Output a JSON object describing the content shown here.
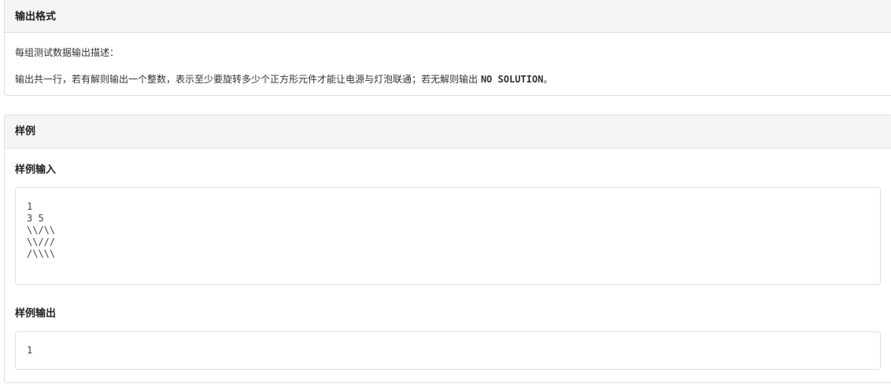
{
  "output_section": {
    "title": "输出格式",
    "desc": "每组测试数据输出描述：",
    "text_before": "输出共一行，若有解则输出一个整数，表示至少要旋转多少个正方形元件才能让电源与灯泡联通；若无解则输出 ",
    "code": "NO SOLUTION",
    "text_after": "。"
  },
  "sample_section": {
    "title": "样例",
    "input_title": "样例输入",
    "input_code": "1\n3 5\n\\\\/\\\\\n\\\\///\n/\\\\\\\\",
    "output_title": "样例输出",
    "output_code": "1"
  }
}
